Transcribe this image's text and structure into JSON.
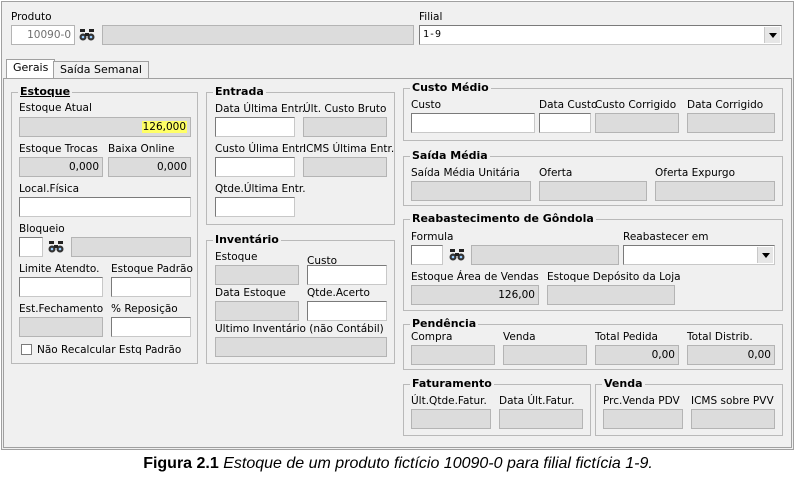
{
  "top": {
    "produto_label": "Produto",
    "produto_value": "10090-0",
    "filial_label": "Filial",
    "filial_value": "1-9"
  },
  "tabs": [
    "Gerais",
    "Saída Semanal"
  ],
  "estoque": {
    "title": "Estoque",
    "atual_label": "Estoque Atual",
    "atual_value": "126,000",
    "trocas_label": "Estoque Trocas",
    "trocas_value": "0,000",
    "baixa_label": "Baixa Online",
    "baixa_value": "0,000",
    "local_label": "Local.Física",
    "bloqueio_label": "Bloqueio",
    "limite_label": "Limite Atendto.",
    "padrao_label": "Estoque Padrão",
    "fechamento_label": "Est.Fechamento",
    "reposicao_label": "% Reposição",
    "checkbox_label": "Não Recalcular Estq Padrão"
  },
  "entrada": {
    "title": "Entrada",
    "data_label": "Data Última Entr.",
    "custo_bruto_label": "Últ. Custo Bruto",
    "custo_label": "Custo Úlima Entr.",
    "icms_label": "ICMS Última Entr.",
    "qtde_label": "Qtde.Última Entr."
  },
  "inventario": {
    "title": "Inventário",
    "estoque_label": "Estoque",
    "custo_label": "Custo",
    "data_label": "Data Estoque",
    "acerto_label": "Qtde.Acerto",
    "ultimo_label": "Ultimo Inventário (não Contábil)"
  },
  "custo_medio": {
    "title": "Custo Médio",
    "custo_label": "Custo",
    "data_custo_label": "Data Custo",
    "corrigido_label": "Custo Corrigido",
    "data_corrigido_label": "Data Corrigido"
  },
  "saida_media": {
    "title": "Saída Média",
    "unitaria_label": "Saída Média Unitária",
    "oferta_label": "Oferta",
    "expurgo_label": "Oferta Expurgo"
  },
  "reabastecimento": {
    "title": "Reabastecimento de Gôndola",
    "formula_label": "Formula",
    "reabastecer_label": "Reabastecer em",
    "area_label": "Estoque Área de Vendas",
    "area_value": "126,00",
    "deposito_label": "Estoque Depósito da Loja"
  },
  "pendencia": {
    "title": "Pendência",
    "compra_label": "Compra",
    "venda_label": "Venda",
    "total_pedida_label": "Total Pedida",
    "total_pedida_value": "0,00",
    "total_distrib_label": "Total  Distrib.",
    "total_distrib_value": "0,00"
  },
  "faturamento": {
    "title": "Faturamento",
    "qtde_label": "Últ.Qtde.Fatur.",
    "data_label": "Data Últ.Fatur."
  },
  "venda": {
    "title": "Venda",
    "prc_label": "Prc.Venda PDV",
    "icms_label": "ICMS sobre PVV"
  },
  "caption": {
    "bold": "Figura 2.1",
    "italic": "Estoque de um produto fictício 10090-0 para filial fictícia 1-9."
  },
  "colors": {
    "window_bg": "#f0f0f0",
    "highlight": "#ffff66",
    "disabled_field": "#dcdcdc"
  }
}
